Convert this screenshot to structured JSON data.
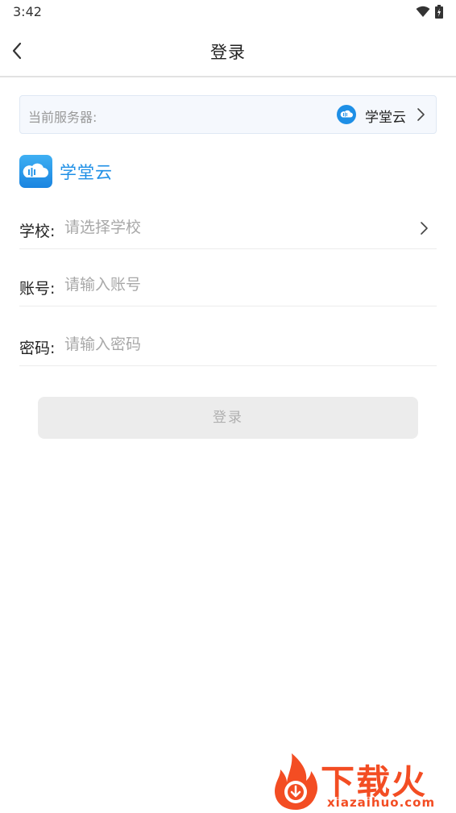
{
  "status_bar": {
    "time": "3:42"
  },
  "nav": {
    "title": "登录"
  },
  "server": {
    "label": "当前服务器:",
    "name": "学堂云"
  },
  "brand": {
    "name": "学堂云",
    "accent_color": "#1e8fe6"
  },
  "form": {
    "school": {
      "label": "学校:",
      "placeholder": "请选择学校"
    },
    "account": {
      "label": "账号:",
      "placeholder": "请输入账号"
    },
    "password": {
      "label": "密码:",
      "placeholder": "请输入密码"
    }
  },
  "login_button": {
    "label": "登录"
  },
  "watermark": {
    "text_cn": "下载火",
    "text_en": "xiazaihuo.com"
  }
}
